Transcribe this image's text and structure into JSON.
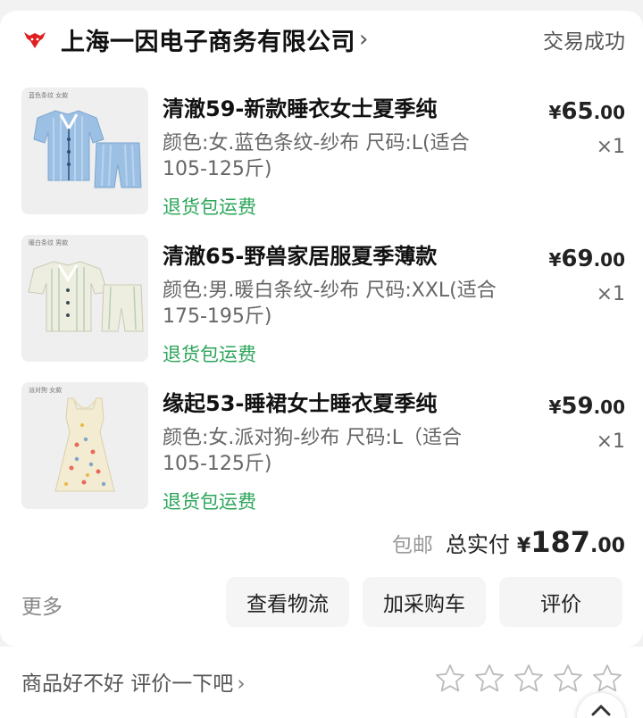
{
  "shop": {
    "name": "上海一因电子商务有限公司",
    "chevron": "›",
    "status": "交易成功",
    "logo_icon": "shop-brand-logo"
  },
  "items": [
    {
      "thumb_tag": "蓝色条纹 女款",
      "title": "清澈59-新款睡衣女士夏季纯",
      "spec": "颜色:女.蓝色条纹-纱布 尺码:L(适合105-125斤)",
      "tag": "退货包运费",
      "price_currency": "¥",
      "price_int": "65",
      "price_dec": ".00",
      "qty": "×1",
      "thumb_color": "#9cc0e4"
    },
    {
      "thumb_tag": "暖白条纹 男款",
      "title": "清澈65-野兽家居服夏季薄款",
      "spec": "颜色:男.暖白条纹-纱布 尺码:XXL(适合175-195斤)",
      "tag": "退货包运费",
      "price_currency": "¥",
      "price_int": "69",
      "price_dec": ".00",
      "qty": "×1",
      "thumb_color": "#eeeee0"
    },
    {
      "thumb_tag": "派对狗 女款",
      "title": "缘起53-睡裙女士睡衣夏季纯",
      "spec": "颜色:女.派对狗-纱布 尺码:L（适合105-125斤)",
      "tag": "退货包运费",
      "price_currency": "¥",
      "price_int": "59",
      "price_dec": ".00",
      "qty": "×1",
      "thumb_color": "#f3ecd2"
    }
  ],
  "summary": {
    "free_shipping": "包邮",
    "total_label": "总实付",
    "total_currency": "¥",
    "total_int": "187",
    "total_dec": ".00"
  },
  "actions": {
    "more": "更多",
    "logistics": "查看物流",
    "add_cart": "加采购车",
    "review": "评价"
  },
  "review_bar": {
    "prompt": "商品好不好 评价一下吧",
    "chevron": "›",
    "rating": 0,
    "max_rating": 5
  },
  "colors": {
    "brand_red": "#e02020",
    "accent_green": "#2ca55a"
  }
}
